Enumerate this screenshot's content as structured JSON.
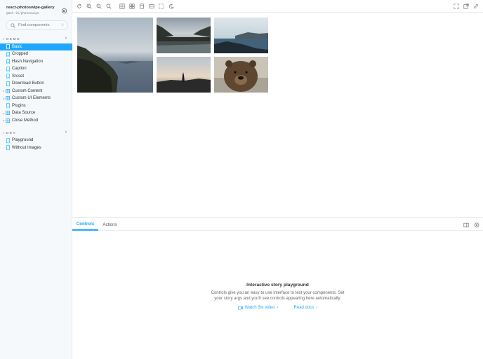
{
  "brand": {
    "title": "react-photoswipe-gallery",
    "subtitle": "@ant-ik/photoswipe"
  },
  "search": {
    "placeholder": "Find components",
    "shortcut": "/"
  },
  "demo_group": {
    "label": "DEMO",
    "items": [
      {
        "label": "Basic",
        "kind": "story",
        "active": true
      },
      {
        "label": "Cropped",
        "kind": "story"
      },
      {
        "label": "Hash Navigation",
        "kind": "story"
      },
      {
        "label": "Caption",
        "kind": "story"
      },
      {
        "label": "Srcset",
        "kind": "story"
      },
      {
        "label": "Download Button",
        "kind": "story"
      },
      {
        "label": "Custom Content",
        "kind": "component"
      },
      {
        "label": "Custom UI Elements",
        "kind": "component"
      },
      {
        "label": "Plugins",
        "kind": "story"
      },
      {
        "label": "Data Source",
        "kind": "component"
      },
      {
        "label": "Close Method",
        "kind": "component"
      }
    ]
  },
  "dev_group": {
    "label": "DEV",
    "items": [
      {
        "label": "Playground",
        "kind": "story"
      },
      {
        "label": "Without Images",
        "kind": "story"
      }
    ]
  },
  "toolbar": {
    "left_icons": [
      "reload-icon",
      "zoom-in-icon",
      "zoom-out-icon",
      "zoom-reset-icon",
      "grid-icon",
      "background-icon",
      "viewport-icon",
      "measure-icon",
      "outline-icon",
      "theme-moon-icon"
    ],
    "right_icons": [
      "fullscreen-icon",
      "open-new-tab-icon",
      "copy-link-icon"
    ]
  },
  "gallery": {
    "photos": [
      "coastal-cliffs-sunset",
      "misty-lake-forest",
      "ocean-horizon-dusk",
      "tree-silhouette-sunrise",
      "brown-bear-portrait"
    ]
  },
  "addons": {
    "tabs": [
      "Controls",
      "Actions"
    ],
    "active_tab": "Controls",
    "empty_title": "Interactive story playground",
    "empty_line1": "Controls give you an easy to use interface to test your components. Set",
    "empty_line2": "your story args and you'll see controls appearing here automatically.",
    "watch_video": "Watch 5m video",
    "read_docs": "Read docs"
  },
  "colors": {
    "accent": "#1ea7fd",
    "sidebar_bg": "#f6f9fc",
    "border": "#e6e9ee"
  }
}
